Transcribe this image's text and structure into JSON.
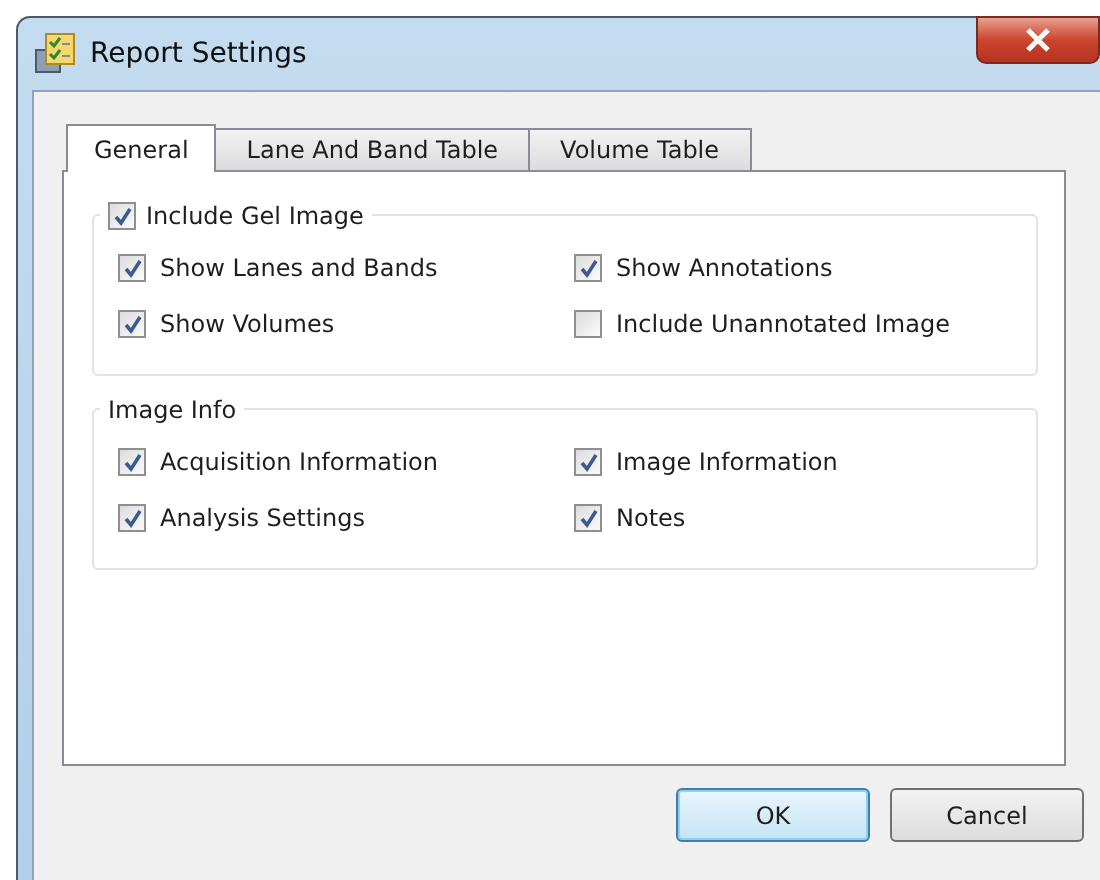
{
  "window": {
    "title": "Report Settings"
  },
  "tabs": [
    {
      "label": "General",
      "selected": true
    },
    {
      "label": "Lane And Band Table",
      "selected": false
    },
    {
      "label": "Volume Table",
      "selected": false
    }
  ],
  "groups": [
    {
      "kind": "checkbox",
      "label": "Include Gel Image",
      "checked": true,
      "options": [
        {
          "label": "Show Lanes and Bands",
          "checked": true
        },
        {
          "label": "Show Annotations",
          "checked": true
        },
        {
          "label": "Show Volumes",
          "checked": true
        },
        {
          "label": "Include Unannotated Image",
          "checked": false
        }
      ]
    },
    {
      "kind": "label",
      "label": "Image Info",
      "options": [
        {
          "label": "Acquisition Information",
          "checked": true
        },
        {
          "label": "Image Information",
          "checked": true
        },
        {
          "label": "Analysis Settings",
          "checked": true
        },
        {
          "label": "Notes",
          "checked": true
        }
      ]
    }
  ],
  "buttons": [
    {
      "label": "OK",
      "default": true
    },
    {
      "label": "Cancel",
      "default": false
    }
  ]
}
